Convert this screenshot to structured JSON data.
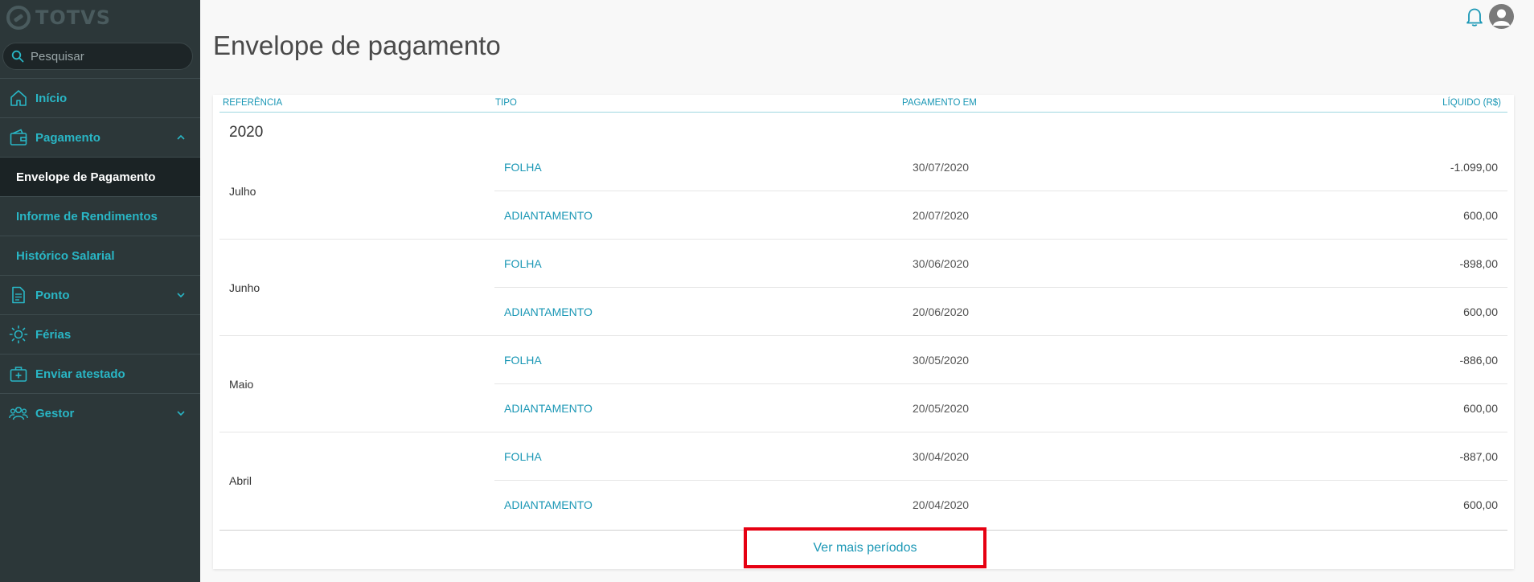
{
  "brand": {
    "logo_text": "TOTVS"
  },
  "search": {
    "placeholder": "Pesquisar"
  },
  "sidebar": {
    "items": [
      {
        "label": "Início",
        "icon": "home-icon"
      },
      {
        "label": "Pagamento",
        "icon": "wallet-icon",
        "expanded": true
      },
      {
        "label": "Envelope de Pagamento",
        "sub": true,
        "active": true
      },
      {
        "label": "Informe de Rendimentos",
        "sub": true
      },
      {
        "label": "Histórico Salarial",
        "sub": true
      },
      {
        "label": "Ponto",
        "icon": "document-icon",
        "expanded": false
      },
      {
        "label": "Férias",
        "icon": "sun-icon"
      },
      {
        "label": "Enviar atestado",
        "icon": "medical-kit-icon"
      },
      {
        "label": "Gestor",
        "icon": "group-icon",
        "expanded": false
      }
    ]
  },
  "page": {
    "title": "Envelope de pagamento"
  },
  "table": {
    "headers": {
      "referencia": "REFERÊNCIA",
      "tipo": "TIPO",
      "pagamento": "PAGAMENTO EM",
      "liquido": "LÍQUIDO (R$)"
    },
    "year": "2020",
    "months": [
      {
        "name": "Julho",
        "rows": [
          {
            "type": "FOLHA",
            "date": "30/07/2020",
            "value": "-1.099,00"
          },
          {
            "type": "ADIANTAMENTO",
            "date": "20/07/2020",
            "value": "600,00"
          }
        ]
      },
      {
        "name": "Junho",
        "rows": [
          {
            "type": "FOLHA",
            "date": "30/06/2020",
            "value": "-898,00"
          },
          {
            "type": "ADIANTAMENTO",
            "date": "20/06/2020",
            "value": "600,00"
          }
        ]
      },
      {
        "name": "Maio",
        "rows": [
          {
            "type": "FOLHA",
            "date": "30/05/2020",
            "value": "-886,00"
          },
          {
            "type": "ADIANTAMENTO",
            "date": "20/05/2020",
            "value": "600,00"
          }
        ]
      },
      {
        "name": "Abril",
        "rows": [
          {
            "type": "FOLHA",
            "date": "30/04/2020",
            "value": "-887,00"
          },
          {
            "type": "ADIANTAMENTO",
            "date": "20/04/2020",
            "value": "600,00"
          }
        ]
      }
    ]
  },
  "more_button": {
    "label": "Ver mais períodos"
  },
  "colors": {
    "accent": "#29b6c5",
    "link": "#1a97b5",
    "sidebar": "#2c3739",
    "highlight": "#e60012"
  }
}
